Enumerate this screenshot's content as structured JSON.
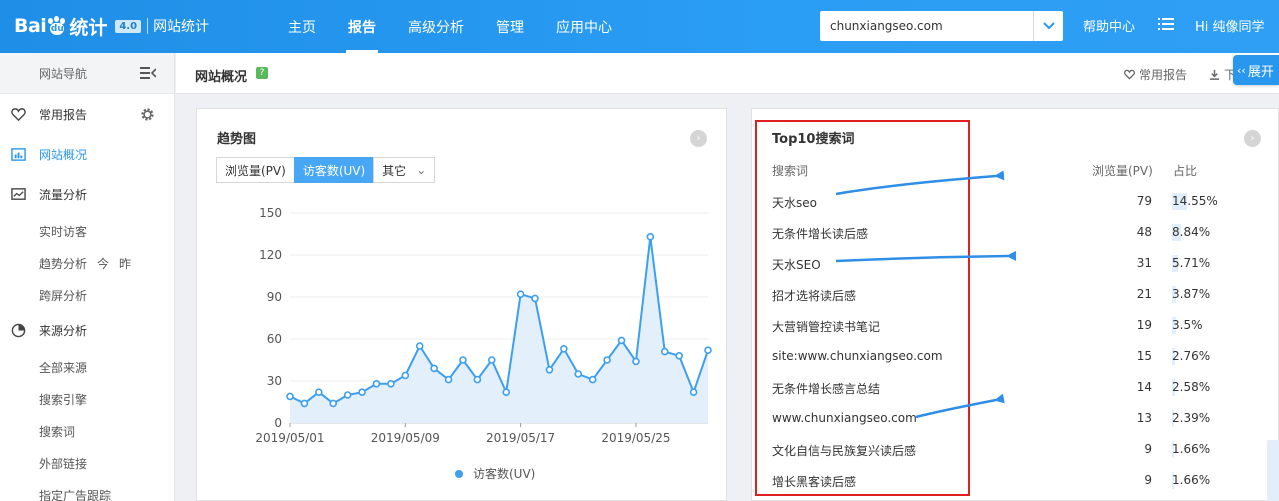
{
  "header": {
    "logo_brand": "Bai",
    "logo_paw_text": "du",
    "logo_product": "统计",
    "logo_badge": "4.0",
    "logo_sub": "网站统计",
    "nav": [
      {
        "label": "主页",
        "active": false
      },
      {
        "label": "报告",
        "active": true
      },
      {
        "label": "高级分析",
        "active": false
      },
      {
        "label": "管理",
        "active": false
      },
      {
        "label": "应用中心",
        "active": false
      }
    ],
    "site": "chunxiangseo.com",
    "help": "帮助中心",
    "greeting": "Hi 纯像同学"
  },
  "sidebar": {
    "title": "网站导航",
    "sections": [
      {
        "label": "常用报告",
        "icon": "heart-icon"
      },
      {
        "label": "网站概况",
        "icon": "overview-icon",
        "active": true
      },
      {
        "label": "流量分析",
        "icon": "traffic-icon"
      },
      {
        "label": "来源分析",
        "icon": "pie-icon"
      }
    ],
    "traffic_items": [
      "实时访客",
      "趋势分析",
      "跨屏分析"
    ],
    "trend_extras": [
      "今",
      "昨"
    ],
    "source_items": [
      "全部来源",
      "搜索引擎",
      "搜索词",
      "外部链接",
      "指定广告跟踪"
    ]
  },
  "content": {
    "title": "网站概况",
    "help_badge": "?",
    "fav_label": "常用报告",
    "download_label": "下",
    "expand_label": "展开"
  },
  "trend": {
    "title": "趋势图",
    "tabs": [
      {
        "label": "浏览量(PV)",
        "active": false
      },
      {
        "label": "访客数(UV)",
        "active": true
      },
      {
        "label": "其它",
        "active": false,
        "dropdown": true
      }
    ]
  },
  "chart_data": {
    "type": "area",
    "series": [
      {
        "name": "访客数(UV)",
        "values": [
          19,
          14,
          22,
          14,
          20,
          22,
          28,
          28,
          34,
          55,
          39,
          31,
          45,
          31,
          45,
          22,
          92,
          89,
          38,
          53,
          35,
          31,
          45,
          59,
          44,
          133,
          51,
          48,
          22,
          52
        ]
      }
    ],
    "x": [
      "2019/05/01",
      "2019/05/02",
      "2019/05/03",
      "2019/05/04",
      "2019/05/05",
      "2019/05/06",
      "2019/05/07",
      "2019/05/08",
      "2019/05/09",
      "2019/05/10",
      "2019/05/11",
      "2019/05/12",
      "2019/05/13",
      "2019/05/14",
      "2019/05/15",
      "2019/05/16",
      "2019/05/17",
      "2019/05/18",
      "2019/05/19",
      "2019/05/20",
      "2019/05/21",
      "2019/05/22",
      "2019/05/23",
      "2019/05/24",
      "2019/05/25",
      "2019/05/26",
      "2019/05/27",
      "2019/05/28",
      "2019/05/29",
      "2019/05/30"
    ],
    "xticks": [
      "2019/05/01",
      "2019/05/09",
      "2019/05/17",
      "2019/05/25"
    ],
    "yticks": [
      0,
      30,
      60,
      90,
      120,
      150
    ],
    "ylim": [
      0,
      150
    ],
    "grid": true,
    "legend": "bottom",
    "color": "#3d9fef",
    "fill": "#e3effa"
  },
  "top10": {
    "title": "Top10搜索词",
    "headers": {
      "keyword": "搜索词",
      "pv": "浏览量(PV)",
      "ratio": "占比"
    },
    "rows": [
      {
        "keyword": "天水seo",
        "pv": "79",
        "ratio": "14.55%",
        "ratio_value": 14.55
      },
      {
        "keyword": "无条件增长读后感",
        "pv": "48",
        "ratio": "8.84%",
        "ratio_value": 8.84
      },
      {
        "keyword": "天水SEO",
        "pv": "31",
        "ratio": "5.71%",
        "ratio_value": 5.71
      },
      {
        "keyword": "招才选将读后感",
        "pv": "21",
        "ratio": "3.87%",
        "ratio_value": 3.87
      },
      {
        "keyword": "大营销管控读书笔记",
        "pv": "19",
        "ratio": "3.5%",
        "ratio_value": 3.5
      },
      {
        "keyword": "site:www.chunxiangseo.com",
        "pv": "15",
        "ratio": "2.76%",
        "ratio_value": 2.76
      },
      {
        "keyword": "无条件增长感言总结",
        "pv": "14",
        "ratio": "2.58%",
        "ratio_value": 2.58
      },
      {
        "keyword": "www.chunxiangseo.com",
        "pv": "13",
        "ratio": "2.39%",
        "ratio_value": 2.39
      },
      {
        "keyword": "文化自信与民族复兴读后感",
        "pv": "9",
        "ratio": "1.66%",
        "ratio_value": 1.66
      },
      {
        "keyword": "增长黑客读后感",
        "pv": "9",
        "ratio": "1.66%",
        "ratio_value": 1.66
      }
    ]
  },
  "annotations": {
    "box_color": "#e02020",
    "arrow_color": "#2e8ee8"
  }
}
